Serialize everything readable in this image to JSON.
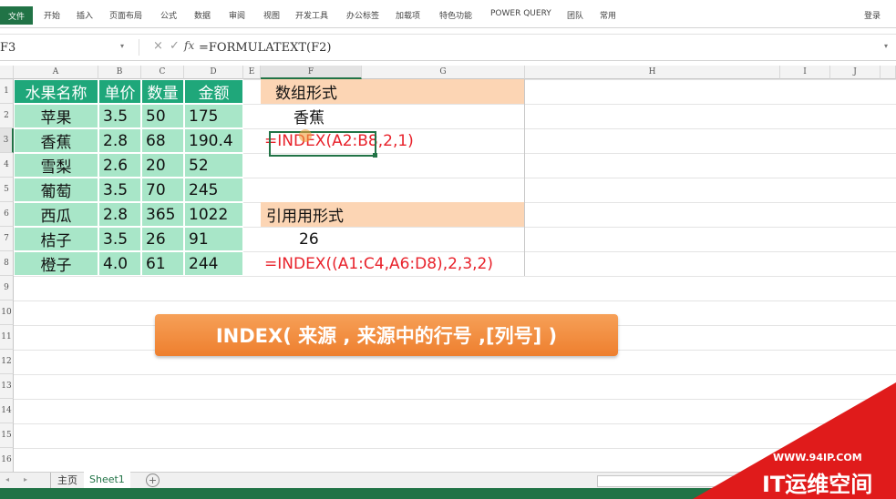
{
  "ribbon": {
    "file_tab": "文件",
    "tabs": [
      "开始",
      "插入",
      "页面布局",
      "公式",
      "数据",
      "审阅",
      "视图",
      "开发工具",
      "办公标签",
      "加载项",
      "特色功能",
      "POWER QUERY",
      "团队",
      "常用"
    ],
    "login": "登录"
  },
  "formula_bar": {
    "name_box": "F3",
    "cancel_icon": "×",
    "enter_icon": "✓",
    "fx_label": "fx",
    "formula": "=FORMULATEXT(F2)"
  },
  "columns": [
    "A",
    "B",
    "C",
    "D",
    "E",
    "F",
    "G",
    "H",
    "I",
    "J"
  ],
  "rows": [
    "1",
    "2",
    "3",
    "4",
    "5",
    "6",
    "7",
    "8",
    "9",
    "10",
    "11",
    "12",
    "13",
    "14",
    "15",
    "16"
  ],
  "table": {
    "headers": [
      "水果名称",
      "单价",
      "数量",
      "金额"
    ],
    "rows": [
      [
        "苹果",
        "3.5",
        "50",
        "175"
      ],
      [
        "香蕉",
        "2.8",
        "68",
        "190.4"
      ],
      [
        "雪梨",
        "2.6",
        "20",
        "52"
      ],
      [
        "葡萄",
        "3.5",
        "70",
        "245"
      ],
      [
        "西瓜",
        "2.8",
        "365",
        "1022"
      ],
      [
        "桔子",
        "3.5",
        "26",
        "91"
      ],
      [
        "橙子",
        "4.0",
        "61",
        "244"
      ]
    ]
  },
  "examples": {
    "array_label": "数组形式",
    "array_result": "香蕉",
    "array_formula": "=INDEX(A2:B8,2,1)",
    "ref_label": "引用用形式",
    "ref_result": "26",
    "ref_formula": "=INDEX((A1:C4,A6:D8),2,3,2)"
  },
  "syntax_banner": "INDEX( 来源 , 来源中的行号 ,[列号] )",
  "sheet_tabs": [
    "主页",
    "Sheet1"
  ],
  "add_sheet_icon": "+",
  "watermark": {
    "url": "WWW.94IP.COM",
    "brand": "IT运维空间"
  },
  "colors": {
    "excel_green": "#217346",
    "table_header_bg": "#1fa77a",
    "table_body_bg": "#a8e6c8",
    "label_bg": "#fcd5b4",
    "formula_red": "#e8222b",
    "banner_orange": "#f0883a",
    "watermark_red": "#e01b1b"
  }
}
